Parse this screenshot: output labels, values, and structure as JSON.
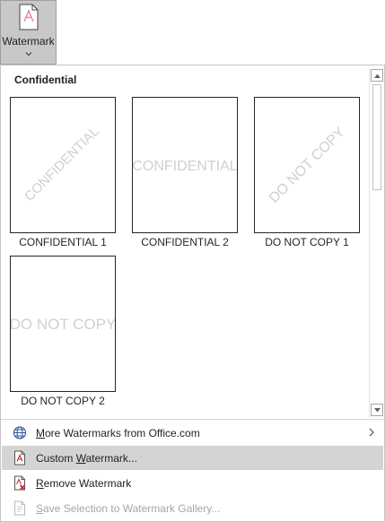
{
  "ribbon": {
    "watermark_label": "Watermark"
  },
  "gallery": {
    "section_title": "Confidential",
    "tiles": [
      {
        "caption": "CONFIDENTIAL 1",
        "watermark_text": "CONFIDENTIAL",
        "style": "diagonal"
      },
      {
        "caption": "CONFIDENTIAL 2",
        "watermark_text": "CONFIDENTIAL",
        "style": "horizontal"
      },
      {
        "caption": "DO NOT COPY 1",
        "watermark_text": "DO NOT COPY",
        "style": "diagonal"
      },
      {
        "caption": "DO NOT COPY 2",
        "watermark_text": "DO NOT COPY",
        "style": "horizontal"
      }
    ]
  },
  "menu": {
    "items": [
      {
        "accel": "M",
        "rest": "ore Watermarks from Office.com",
        "icon": "globe-icon",
        "state": "normal"
      },
      {
        "pre": "Custom ",
        "accel": "W",
        "rest": "atermark...",
        "icon": "document-icon",
        "state": "highlight"
      },
      {
        "accel": "R",
        "rest": "emove Watermark",
        "icon": "remove-watermark-icon",
        "state": "normal"
      },
      {
        "accel": "S",
        "rest": "ave Selection to Watermark Gallery...",
        "icon": "save-selection-icon",
        "state": "disabled"
      }
    ]
  },
  "colors": {
    "watermark_gray": "#d0d0d0",
    "accent_red": "#c4262e",
    "globe_blue": "#2b579a",
    "highlight": "#d4d4d4",
    "disabled_text": "#a6a6a6"
  }
}
